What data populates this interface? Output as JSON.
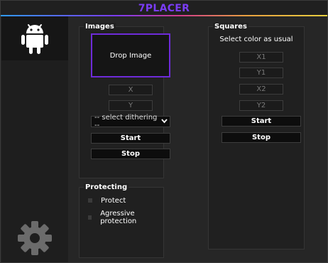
{
  "app": {
    "title": "7PLACER",
    "title_color": "#7a3cf5"
  },
  "sidebar": {
    "items": [
      {
        "icon": "android-icon",
        "active": true
      },
      {
        "icon": "gear-icon",
        "active": false
      }
    ]
  },
  "images": {
    "title": "Images",
    "drop_label": "Drop Image",
    "x_placeholder": "X",
    "y_placeholder": "Y",
    "dithering_selected": "-- select dithering --",
    "start_label": "Start",
    "stop_label": "Stop"
  },
  "protecting": {
    "title": "Protecting",
    "options": [
      {
        "label": "Protect",
        "checked": false
      },
      {
        "label": "Agressive protection",
        "checked": false
      }
    ]
  },
  "squares": {
    "title": "Squares",
    "hint": "Select color as usual",
    "x1_placeholder": "X1",
    "y1_placeholder": "Y1",
    "x2_placeholder": "X2",
    "y2_placeholder": "Y2",
    "start_label": "Start",
    "stop_label": "Stop"
  },
  "colors": {
    "accent": "#6e2bd9",
    "background": "#262626",
    "panel": "#202020",
    "icon": "#ffffff",
    "gear": "#6b6b6b"
  }
}
